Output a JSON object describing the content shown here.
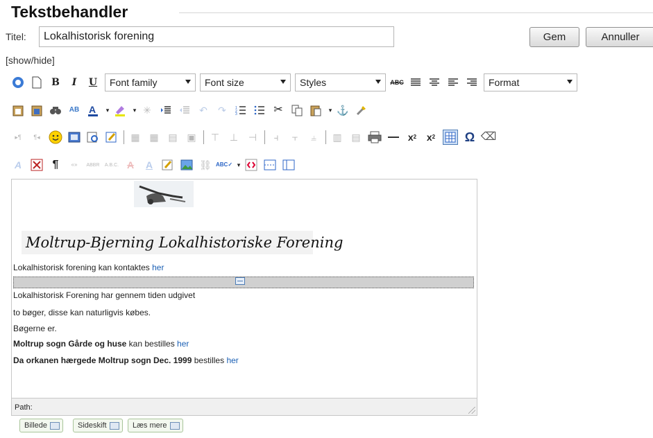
{
  "header": {
    "title": "Tekstbehandler",
    "titel_label": "Titel:",
    "titel_value": "Lokalhistorisk forening",
    "save_label": "Gem",
    "cancel_label": "Annuller",
    "toggle_label": "[show/hide]"
  },
  "toolbar": {
    "font_family": "Font family",
    "font_size": "Font size",
    "styles": "Styles",
    "format": "Format"
  },
  "editor": {
    "heading": "Moltrup-Bjerning Lokalhistoriske Forening",
    "contact_text": "Lokalhistorisk forening kan kontaktes ",
    "link_her": "her",
    "p1": "Lokalhistorisk Forening har gennem tiden udgivet",
    "p2": "to bøger, disse kan naturligvis købes.",
    "p3": "Bøgerne er.",
    "book1": "Moltrup sogn Gårde og huse",
    "book1_suffix": " kan bestilles ",
    "book2": "Da orkanen hærgede Moltrup sogn Dec. 1999",
    "book2_suffix": " bestilles ",
    "path_label": "Path:"
  },
  "bottom_buttons": {
    "image": "Billede",
    "pagebreak": "Sideskift",
    "readmore": "Læs mere"
  },
  "colors": {
    "link": "#1a5fb4",
    "pagebreak_bg": "#d0d0d0"
  }
}
